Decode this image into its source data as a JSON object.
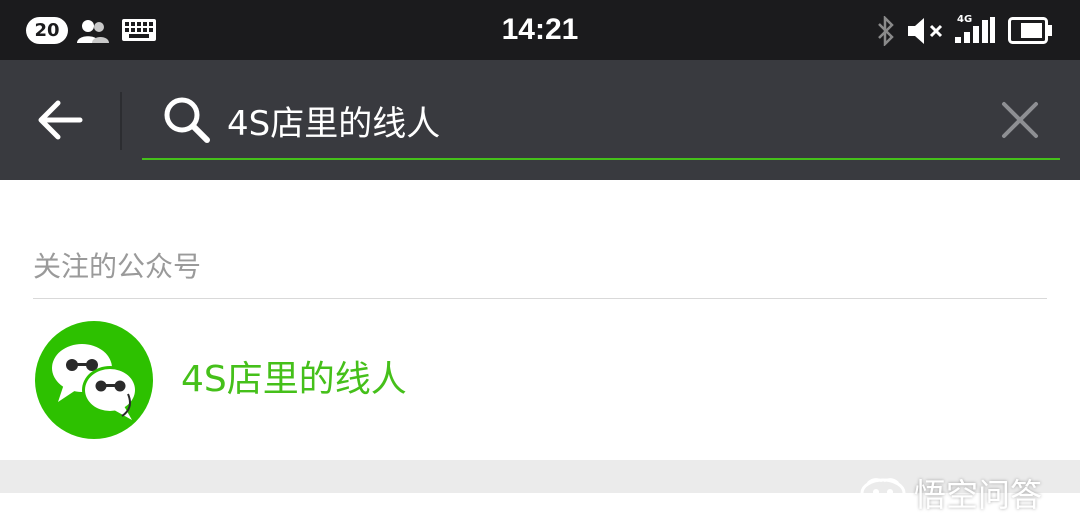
{
  "status_bar": {
    "notification_count": "20",
    "time": "14:21",
    "network": "4G",
    "icons": [
      "contacts-icon",
      "keyboard-icon",
      "bluetooth-icon",
      "mute-icon",
      "signal-icon",
      "battery-icon"
    ]
  },
  "toolbar": {
    "back_icon": "arrow-left-icon",
    "search_icon": "search-icon",
    "search_value": "4S店里的线人",
    "clear_icon": "close-icon",
    "accent_color": "#45c01a",
    "background_color": "#393a3f"
  },
  "results": {
    "section_title": "关注的公众号",
    "items": [
      {
        "name": "4S店里的线人",
        "avatar_icon": "wechat-logo-icon"
      }
    ]
  },
  "watermark": {
    "text": "悟空问答"
  }
}
